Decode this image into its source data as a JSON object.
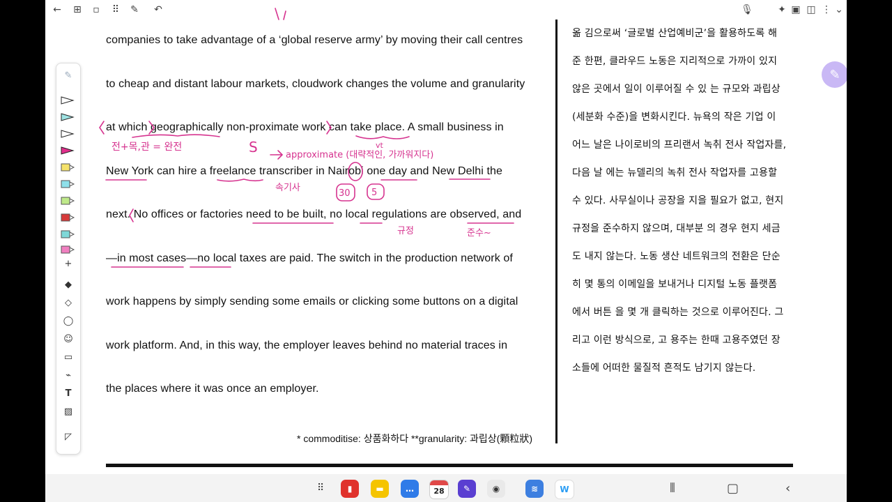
{
  "english_lines": [
    "companies to take advantage of a ‘global reserve army’ by moving their call centres",
    "to cheap and distant labour markets, cloudwork changes the volume and granularity",
    "at which geographically non-proximate work can take place. A small business in",
    "New York can hire a freelance transcriber in Nairobi one day and New Delhi the",
    "next. No offices or factories need to be built, no local regulations are observed, and",
    "—in most cases—no local taxes are paid. The switch in the production network of",
    "work happens by simply sending some emails or clicking some buttons on a digital",
    "work platform. And, in this way, the employer leaves behind no material traces in",
    "the places where it was once an employer."
  ],
  "korean_lines": [
    "옮 김으로써 ‘글로벌 산업예비군’을 활용하도록 해",
    "준 한편, 클라우드 노동은 지리적으로 가까이 있지",
    "않은 곳에서 일이 이루어질 수 있 는 규모와 과립상",
    "(세분화 수준)을 변화시킨다. 뉴욕의 작은 기업 이",
    "어느 날은 나이로비의 프리랜서 녹취 전사 작업자를,",
    "다음 날 에는 뉴델리의 녹취 전사 작업자를 고용할",
    "수 있다. 사무실이나 공장을 지을 필요가 없고, 현지",
    "규정을 준수하지 않으며, 대부분 의 경우 현지 세금",
    "도 내지 않는다. 노동 생산 네트워크의 전환은 단순",
    "히 몇 통의 이메일을 보내거나 디지털 노동 플랫폼",
    "에서 버튼 을 몇 개 클릭하는 것으로 이루어진다. 그",
    "리고 이런 방식으로, 고 용주는 한때 고용주였던 장",
    "소들에 어떠한 물질적 흔적도 남기지 않는다."
  ],
  "footnote": "* commoditise: 상품화하다 **granularity: 과립상(顆粒狀)",
  "handwriting": {
    "note1": "전+목,관 = 완전",
    "note2": "S",
    "note3": "→ approximate (대략적인, 가까워지다)",
    "note4": "vt",
    "note5": "속기사",
    "note6": "30",
    "note7": "5",
    "note8": "규정",
    "note9": "준수~"
  },
  "nav": {
    "calendar_date": "28"
  },
  "colors": {
    "ink": "#d6338f",
    "accent_pen": "#c9b8f5"
  }
}
